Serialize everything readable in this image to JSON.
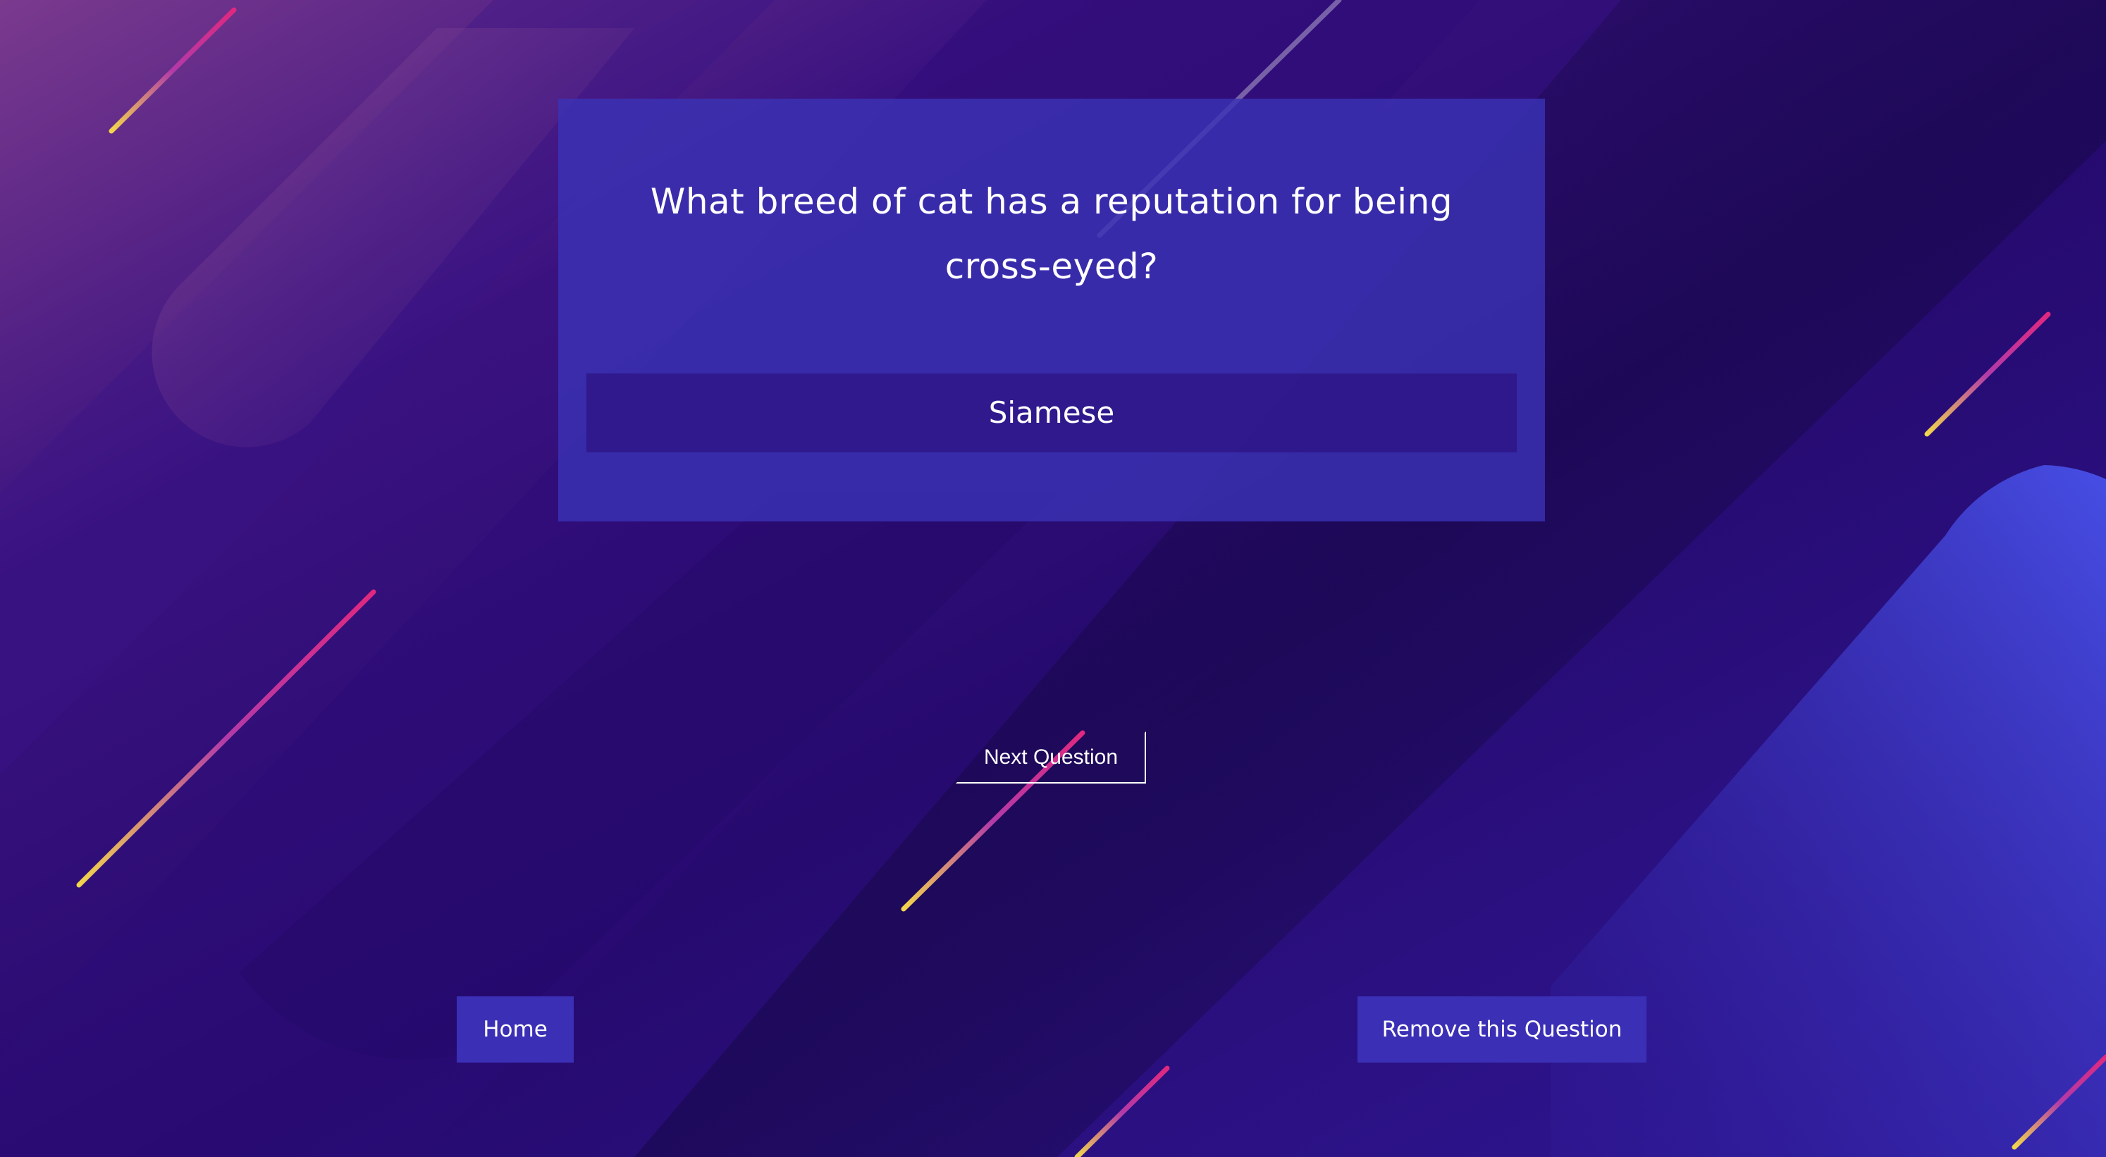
{
  "quiz": {
    "question": "What breed of cat has a reputation for being cross-eyed?",
    "answer": "Siamese"
  },
  "controls": {
    "next_label": "Next Question",
    "home_label": "Home",
    "remove_label": "Remove this Question"
  },
  "colors": {
    "background": "#2a0777",
    "card": "#3b32b4",
    "answer_box": "#2d1282",
    "button": "#3b2fb6",
    "text": "#ffffff",
    "accent_pink": "#e0287f",
    "accent_yellow": "#f2d64b"
  }
}
